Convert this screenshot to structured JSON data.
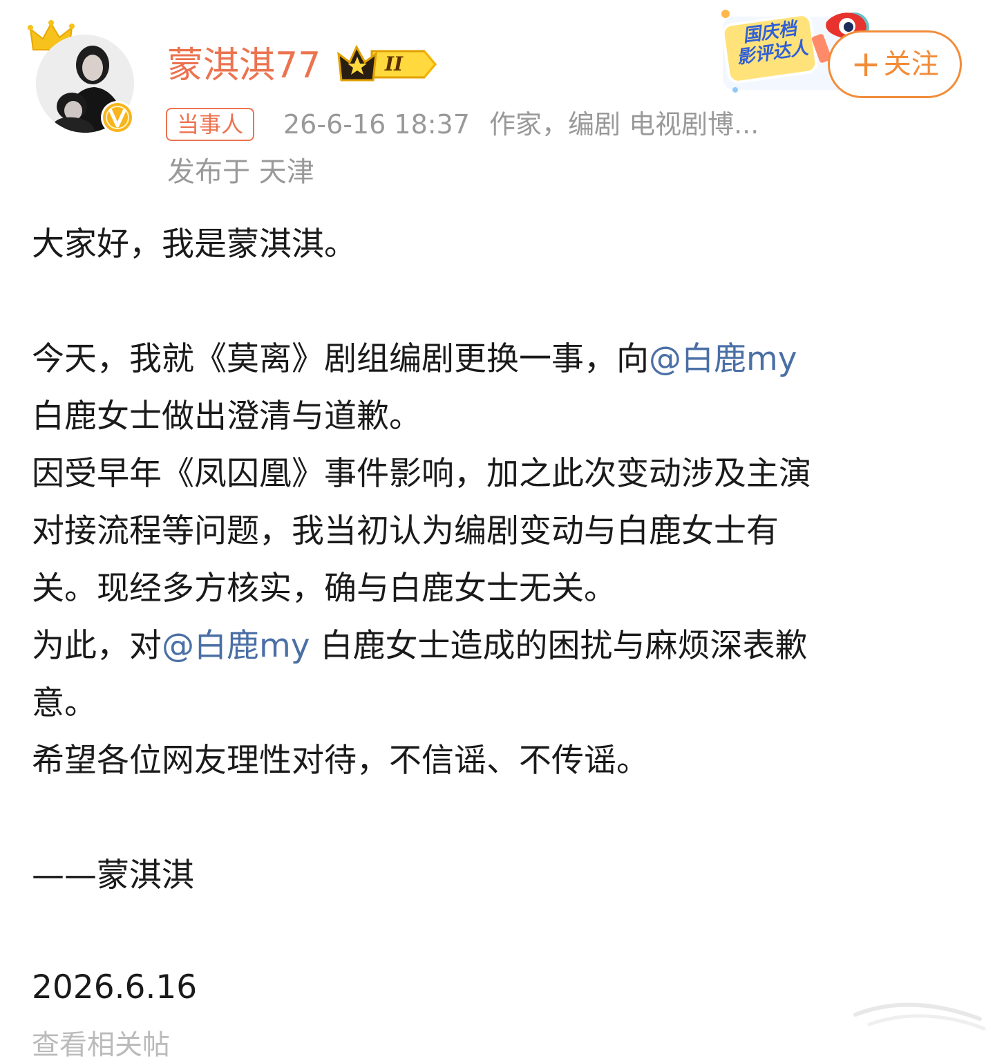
{
  "post": {
    "author": {
      "name": "蒙淇淇77",
      "vip_level": "II",
      "role_tag": "当事人",
      "description": "作家，编剧 电视剧博...",
      "location": "发布于 天津"
    },
    "time": "26-6-16 18:37",
    "event_badge": {
      "line1": "国庆档",
      "line2": "影评达人"
    },
    "follow_label": "关注",
    "follow_icon": "plus-icon",
    "body": {
      "p1": "大家好，我是蒙淇淇。",
      "p2_before": "今天，我就《莫离》剧组编剧更换一事，向",
      "mention": "@白鹿my",
      "p2_line2": "白鹿女士做出澄清与道歉。",
      "p3_line1": "因受早年《凤囚凰》事件影响，加之此次变动涉及主演",
      "p3_line2": "对接流程等问题，我当初认为编剧变动与白鹿女士有",
      "p3_line3": "关。现经多方核实，确与白鹿女士无关。",
      "p4_before": "为此，对",
      "p4_after": " 白鹿女士造成的困扰与麻烦深表歉",
      "p4_line2": "意。",
      "p5": "希望各位网友理性对待，不信谣、不传谣。",
      "signature": "——蒙淇淇",
      "date": "2026.6.16"
    },
    "footer_cut": "查看相关帖"
  },
  "colors": {
    "accent_orange": "#eb7350",
    "follow_orange": "#f28c39",
    "mention_blue": "#4a6fa5",
    "meta_gray": "#999999",
    "text": "#1a1a1a"
  }
}
